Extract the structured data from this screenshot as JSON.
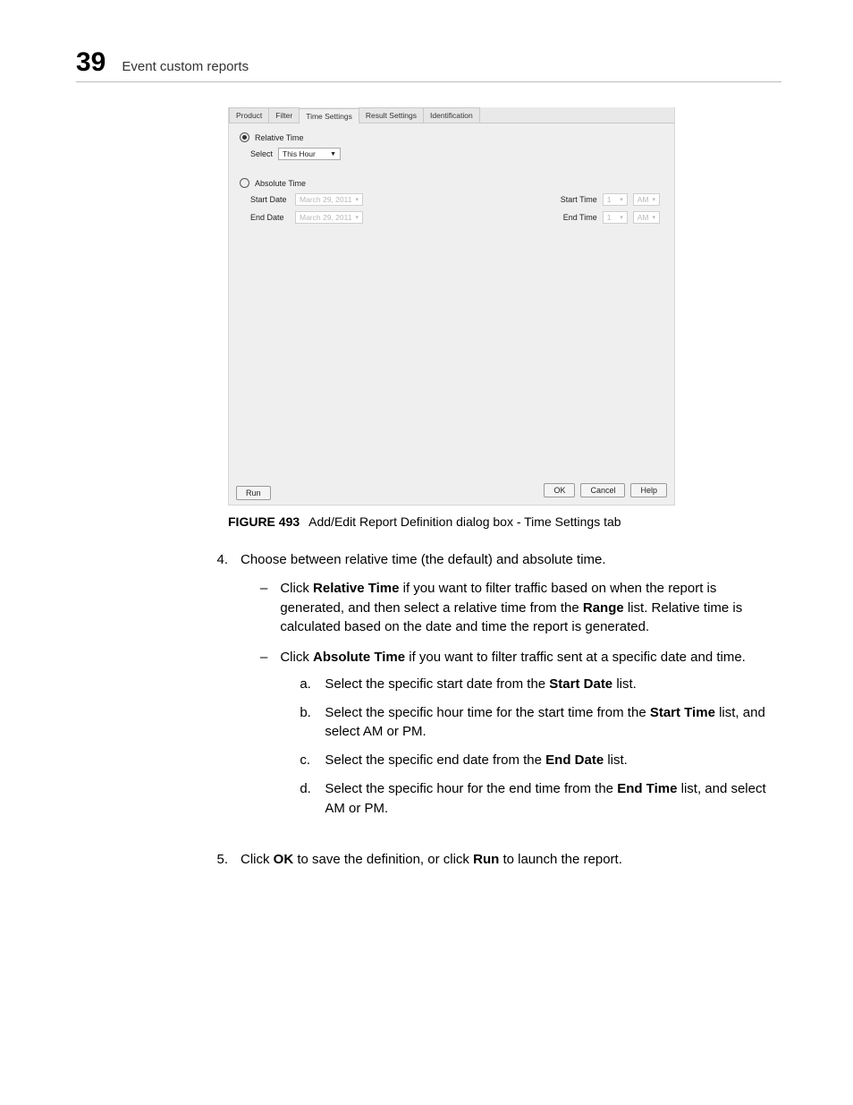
{
  "header": {
    "pageNumber": "39",
    "sectionTitle": "Event custom reports"
  },
  "dialog": {
    "tabs": {
      "product": "Product",
      "filter": "Filter",
      "timeSettings": "Time Settings",
      "resultSettings": "Result Settings",
      "identification": "Identification"
    },
    "relativeTimeLabel": "Relative Time",
    "selectLabel": "Select",
    "selectValue": "This Hour",
    "absoluteTimeLabel": "Absolute Time",
    "startDateLabel": "Start Date",
    "startDateValue": "March 29, 2011",
    "endDateLabel": "End Date",
    "endDateValue": "March 29, 2011",
    "startTimeLabel": "Start Time",
    "startTimeHour": "1",
    "startTimeAmPm": "AM",
    "endTimeLabel": "End Time",
    "endTimeHour": "1",
    "endTimeAmPm": "AM",
    "buttons": {
      "run": "Run",
      "ok": "OK",
      "cancel": "Cancel",
      "help": "Help"
    }
  },
  "figure": {
    "label": "FIGURE 493",
    "caption": "Add/Edit Report Definition dialog box - Time Settings tab"
  },
  "steps": {
    "s4num": "4.",
    "s4text": "Choose between relative time (the default) and absolute time.",
    "relA": "Click ",
    "relBold": "Relative Time",
    "relB": " if you want to filter traffic based on when the report is generated, and then select a relative time from the ",
    "rangeBold": "Range",
    "relC": " list. Relative time is calculated based on the date and time the report is generated.",
    "absA": "Click ",
    "absBold": "Absolute Time",
    "absB": " if you want to filter traffic sent at a specific date and time.",
    "a_l": "a.",
    "a_1a": "Select the specific start date from the ",
    "a_1bold": "Start Date",
    "a_1b": " list.",
    "b_l": "b.",
    "b_1a": "Select the specific hour time for the start time from the ",
    "b_1bold": "Start Time",
    "b_1b": " list, and select AM or PM.",
    "c_l": "c.",
    "c_1a": "Select the specific end date from the ",
    "c_1bold": "End Date",
    "c_1b": " list.",
    "d_l": "d.",
    "d_1a": "Select the specific hour for the end time from the ",
    "d_1bold": "End Time",
    "d_1b": " list, and select AM or PM.",
    "s5num": "5.",
    "s5a": "Click ",
    "s5okBold": "OK",
    "s5b": " to save the definition, or click ",
    "s5runBold": "Run",
    "s5c": " to launch the report."
  }
}
